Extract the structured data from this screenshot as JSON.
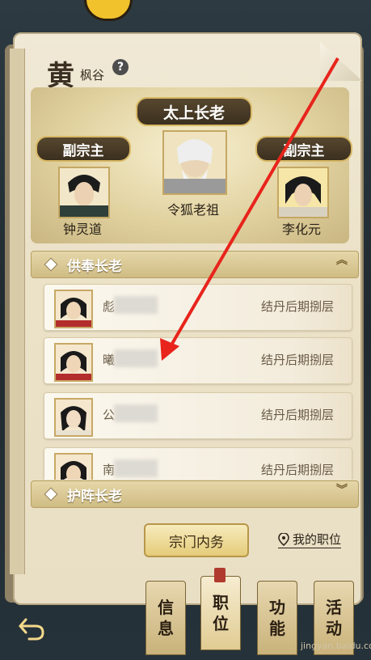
{
  "header": {
    "char": "黄",
    "subtitle": "枫谷",
    "help": "?"
  },
  "leader": {
    "title": "太上长老",
    "center_name": "令狐老祖",
    "left_title": "副宗主",
    "left_name": "钟灵道",
    "right_title": "副宗主",
    "right_name": "李化元"
  },
  "sections": {
    "gongfeng": {
      "title": "供奉长老",
      "chevron": "︽"
    },
    "huzhen": {
      "title": "护阵长老",
      "chevron": "︾"
    }
  },
  "members": [
    {
      "name_char": "彪",
      "rank": "结丹后期捌层"
    },
    {
      "name_char": "曦",
      "rank": "结丹后期捌层"
    },
    {
      "name_char": "公",
      "rank": "结丹后期捌层"
    },
    {
      "name_char": "南",
      "rank": "结丹后期捌层"
    }
  ],
  "actions": {
    "affairs": "宗门内务",
    "my_position": "我的职位"
  },
  "tabs": [
    {
      "line1": "信",
      "line2": "息"
    },
    {
      "line1": "职",
      "line2": "位"
    },
    {
      "line1": "功",
      "line2": "能"
    },
    {
      "line1": "活",
      "line2": "动"
    }
  ],
  "watermark": "jingyan.baidu.com",
  "colors": {
    "arrow": "#e8241c",
    "accent_gold": "#d8b865"
  }
}
